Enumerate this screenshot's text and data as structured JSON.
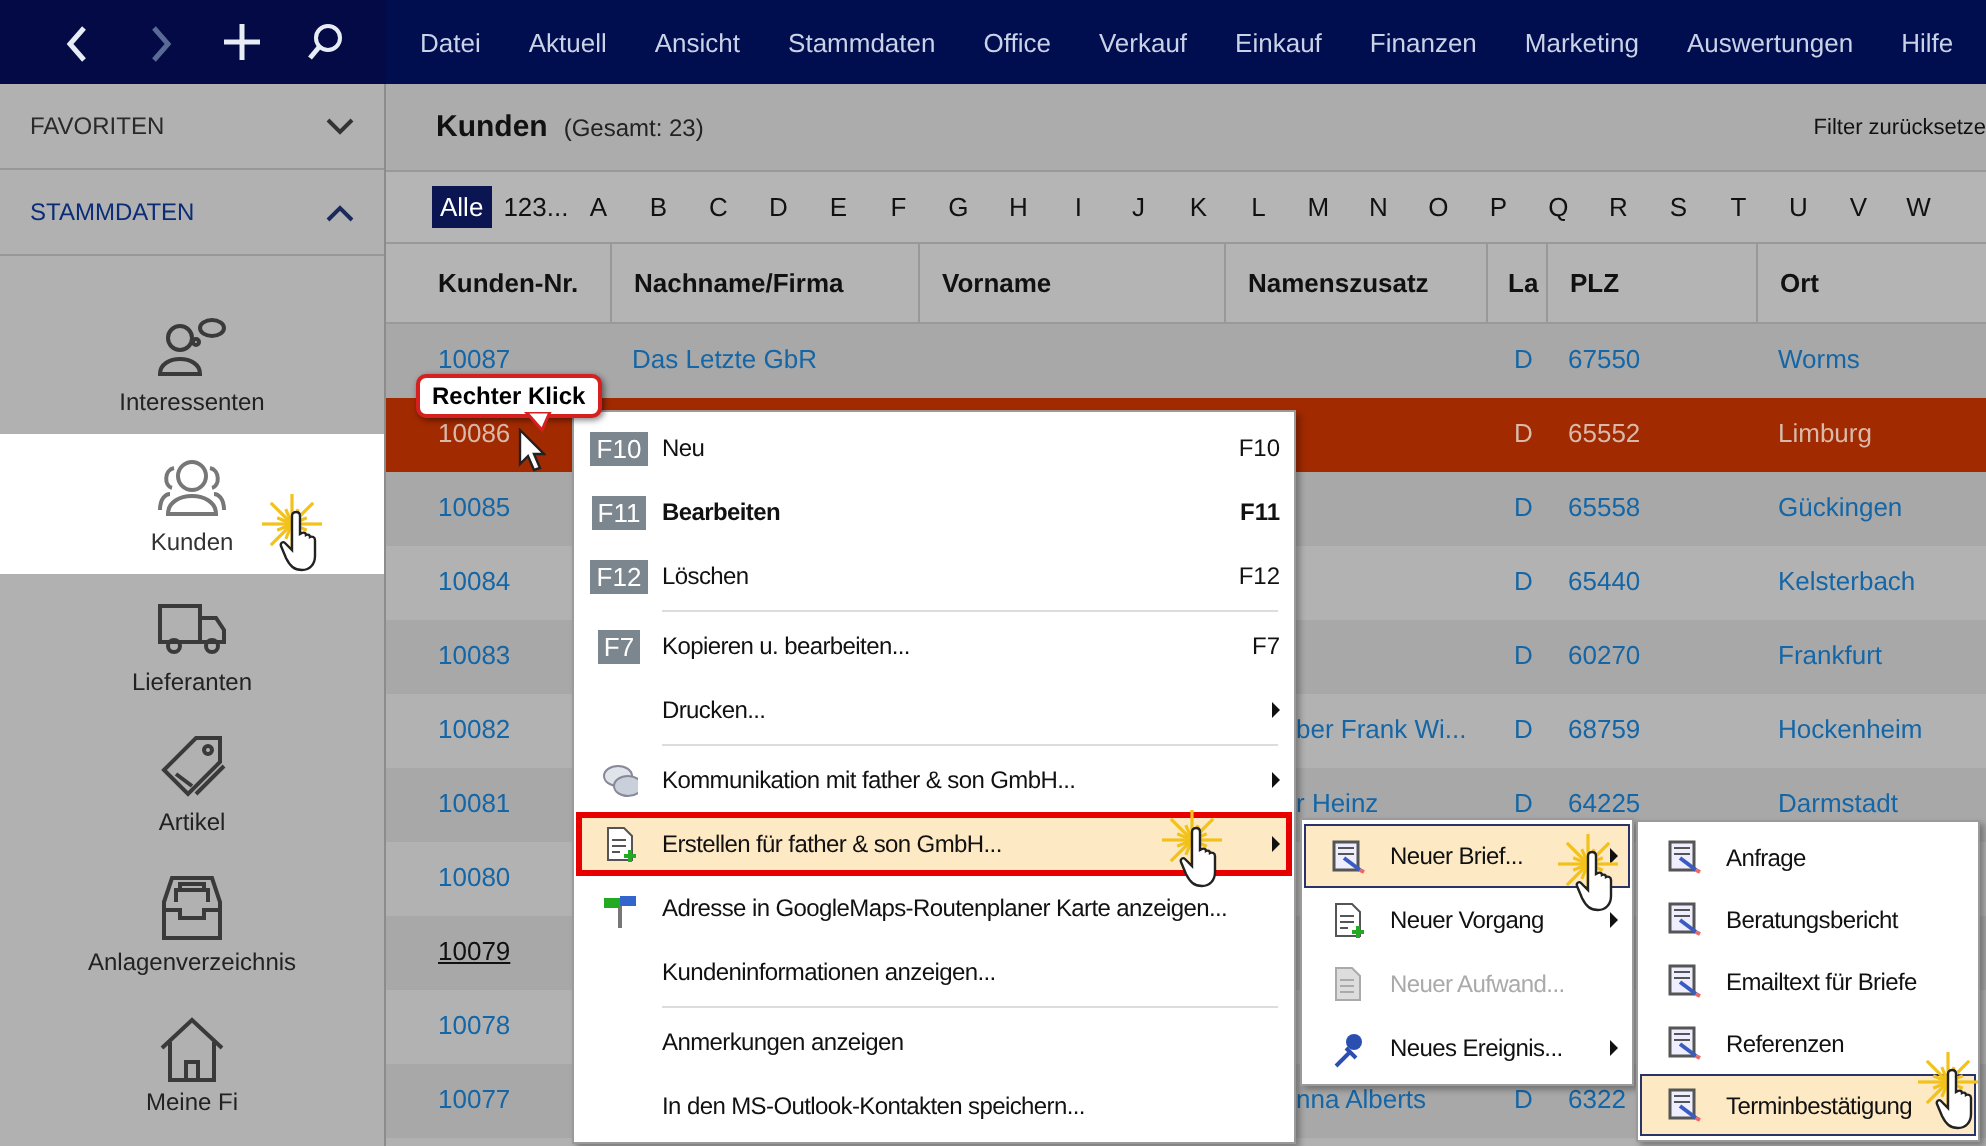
{
  "nav_buttons": [
    {
      "kind": "back",
      "disabled": false
    },
    {
      "kind": "forward",
      "disabled": true
    },
    {
      "kind": "add",
      "disabled": false
    },
    {
      "kind": "search",
      "disabled": false
    }
  ],
  "menu_bar": [
    "Datei",
    "Aktuell",
    "Ansicht",
    "Stammdaten",
    "Office",
    "Verkauf",
    "Einkauf",
    "Finanzen",
    "Marketing",
    "Auswertungen",
    "Hilfe"
  ],
  "sidebar": {
    "sections": [
      {
        "title": "FAVORITEN",
        "expanded": false
      },
      {
        "title": "STAMMDATEN",
        "expanded": true
      }
    ],
    "items": [
      {
        "label": "Interessenten",
        "selected": false
      },
      {
        "label": "Kunden",
        "selected": true
      },
      {
        "label": "Lieferanten",
        "selected": false
      },
      {
        "label": "Artikel",
        "selected": false
      },
      {
        "label": "Anlagenverzeichnis",
        "selected": false
      },
      {
        "label": "Meine Fi",
        "selected": false
      }
    ]
  },
  "list": {
    "title": "Kunden",
    "count": "(Gesamt: 23)",
    "filter_reset": "Filter zurücksetze",
    "letters": [
      {
        "label": "Alle",
        "selected": true
      },
      {
        "label": "123...",
        "selected": false
      },
      {
        "label": "A",
        "selected": false
      },
      {
        "label": "B",
        "selected": false
      },
      {
        "label": "C",
        "selected": false
      },
      {
        "label": "D",
        "selected": false
      },
      {
        "label": "E",
        "selected": false
      },
      {
        "label": "F",
        "selected": false
      },
      {
        "label": "G",
        "selected": false
      },
      {
        "label": "H",
        "selected": false
      },
      {
        "label": "I",
        "selected": false
      },
      {
        "label": "J",
        "selected": false
      },
      {
        "label": "K",
        "selected": false
      },
      {
        "label": "L",
        "selected": false
      },
      {
        "label": "M",
        "selected": false
      },
      {
        "label": "N",
        "selected": false
      },
      {
        "label": "O",
        "selected": false
      },
      {
        "label": "P",
        "selected": false
      },
      {
        "label": "Q",
        "selected": false
      },
      {
        "label": "R",
        "selected": false
      },
      {
        "label": "S",
        "selected": false
      },
      {
        "label": "T",
        "selected": false
      },
      {
        "label": "U",
        "selected": false
      },
      {
        "label": "V",
        "selected": false
      },
      {
        "label": "W",
        "selected": false
      }
    ],
    "columns": [
      "Kunden-Nr.",
      "Nachname/Firma",
      "Vorname",
      "Namenszusatz",
      "La",
      "PLZ",
      "Ort"
    ],
    "rows": [
      {
        "kunden_nr": "10087",
        "nachname": "Das Letzte GbR",
        "land": "D",
        "plz": "67550",
        "ort": "Worms",
        "selected": false,
        "hovered": false
      },
      {
        "kunden_nr": "10086",
        "land": "D",
        "plz": "65552",
        "ort": "Limburg",
        "selected": true,
        "hovered": false
      },
      {
        "kunden_nr": "10085",
        "land": "D",
        "plz": "65558",
        "ort": "Gückingen",
        "selected": false,
        "hovered": false
      },
      {
        "kunden_nr": "10084",
        "land": "D",
        "plz": "65440",
        "ort": "Kelsterbach",
        "selected": false,
        "hovered": false
      },
      {
        "kunden_nr": "10083",
        "land": "D",
        "plz": "60270",
        "ort": "Frankfurt",
        "selected": false,
        "hovered": false
      },
      {
        "kunden_nr": "10082",
        "namenszusatz": "ber Frank Wi...",
        "land": "D",
        "plz": "68759",
        "ort": "Hockenheim",
        "selected": false,
        "hovered": false
      },
      {
        "kunden_nr": "10081",
        "namenszusatz": "r Heinz",
        "land": "D",
        "plz": "64225",
        "ort": "Darmstadt",
        "selected": false,
        "hovered": false
      },
      {
        "kunden_nr": "10080",
        "selected": false,
        "hovered": false
      },
      {
        "kunden_nr": "10079",
        "selected": false,
        "hovered": true
      },
      {
        "kunden_nr": "10078",
        "selected": false,
        "hovered": false
      },
      {
        "kunden_nr": "10077",
        "namenszusatz": "nna Alberts",
        "land": "D",
        "plz": "6322",
        "selected": false,
        "hovered": false
      }
    ]
  },
  "context_menu": {
    "items": [
      {
        "kind": "item",
        "badge": "F10",
        "label": "Neu",
        "shortcut": "F10",
        "bold": false,
        "submenu": false,
        "selected": false,
        "annotated": false
      },
      {
        "kind": "item",
        "badge": "F11",
        "label": "Bearbeiten",
        "shortcut": "F11",
        "bold": true,
        "submenu": false,
        "selected": false,
        "annotated": false
      },
      {
        "kind": "item",
        "badge": "F12",
        "label": "Löschen",
        "shortcut": "F12",
        "bold": false,
        "submenu": false,
        "selected": false,
        "annotated": false
      },
      {
        "kind": "separator"
      },
      {
        "kind": "item",
        "badge": "F7",
        "label": "Kopieren u. bearbeiten...",
        "shortcut": "F7",
        "bold": false,
        "submenu": false,
        "selected": false,
        "annotated": false
      },
      {
        "kind": "item",
        "label": "Drucken...",
        "bold": false,
        "submenu": true,
        "selected": false,
        "annotated": false
      },
      {
        "kind": "separator"
      },
      {
        "kind": "item",
        "label": "Kommunikation mit father & son GmbH...",
        "bold": false,
        "submenu": true,
        "selected": false,
        "annotated": false
      },
      {
        "kind": "item",
        "label": "Erstellen für father & son GmbH...",
        "bold": false,
        "submenu": true,
        "selected": true,
        "annotated": true
      },
      {
        "kind": "item",
        "label": "Adresse in GoogleMaps-Routenplaner Karte anzeigen...",
        "bold": false,
        "submenu": false,
        "selected": false,
        "annotated": false
      },
      {
        "kind": "item",
        "label": "Kundeninformationen anzeigen...",
        "bold": false,
        "submenu": false,
        "selected": false,
        "annotated": false
      },
      {
        "kind": "separator"
      },
      {
        "kind": "item",
        "label": "Anmerkungen anzeigen",
        "bold": false,
        "submenu": false,
        "selected": false,
        "annotated": false
      },
      {
        "kind": "item",
        "label": "In den MS-Outlook-Kontakten speichern...",
        "bold": false,
        "submenu": false,
        "selected": false,
        "annotated": false
      }
    ]
  },
  "create_submenu": {
    "items": [
      {
        "kind": "item",
        "label": "Neuer Brief...",
        "submenu": true,
        "selected": true,
        "disabled": false
      },
      {
        "kind": "item",
        "label": "Neuer Vorgang",
        "submenu": true,
        "selected": false,
        "disabled": false
      },
      {
        "kind": "item",
        "label": "Neuer Aufwand...",
        "submenu": false,
        "selected": false,
        "disabled": true
      },
      {
        "kind": "item",
        "label": "Neues Ereignis...",
        "submenu": true,
        "selected": false,
        "disabled": false
      }
    ]
  },
  "letter_submenu": {
    "items": [
      {
        "kind": "item",
        "label": "Anfrage",
        "selected": false
      },
      {
        "kind": "item",
        "label": "Beratungsbericht",
        "selected": false
      },
      {
        "kind": "item",
        "label": "Emailtext für Briefe",
        "selected": false
      },
      {
        "kind": "item",
        "label": "Referenzen",
        "selected": false
      },
      {
        "kind": "item",
        "label": "Terminbestätigung",
        "selected": true
      }
    ]
  },
  "callout": {
    "text": "Rechter Klick"
  }
}
